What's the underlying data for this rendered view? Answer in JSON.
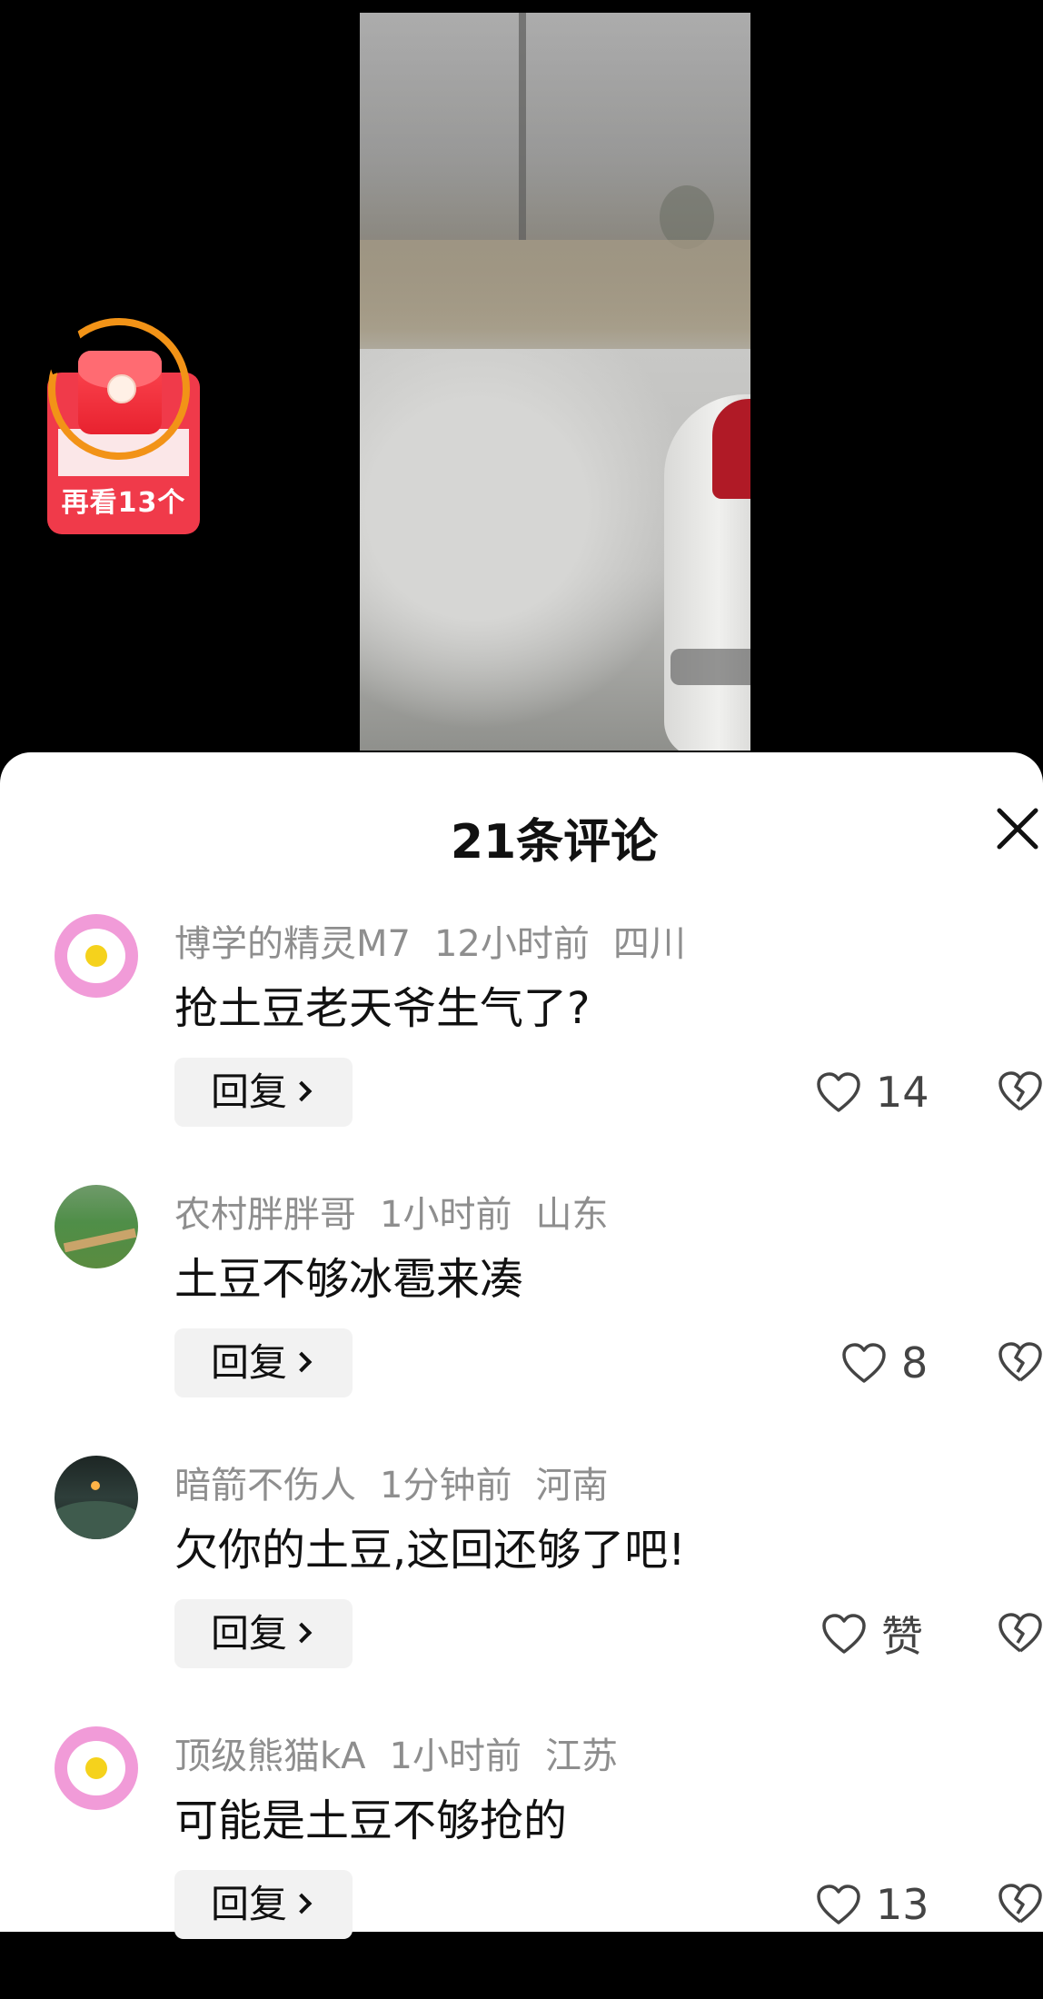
{
  "redpacket": {
    "label": "再看13个"
  },
  "sheet": {
    "title": "21条评论"
  },
  "comments": [
    {
      "username": "博学的精灵M7",
      "time": "12小时前",
      "location": "四川",
      "text": "抢土豆老天爷生气了?",
      "reply_label": "回复",
      "like_label": "14",
      "avatar": "egg-avatar"
    },
    {
      "username": "农村胖胖哥",
      "time": "1小时前",
      "location": "山东",
      "text": "土豆不够冰雹来凑",
      "reply_label": "回复",
      "like_label": "8",
      "avatar": "field-avatar"
    },
    {
      "username": "暗箭不伤人",
      "time": "1分钟前",
      "location": "河南",
      "text": "欠你的土豆,这回还够了吧!",
      "reply_label": "回复",
      "like_label": "赞",
      "avatar": "night-avatar"
    },
    {
      "username": "顶级熊猫kA",
      "time": "1小时前",
      "location": "江苏",
      "text": "可能是土豆不够抢的",
      "reply_label": "回复",
      "like_label": "13",
      "avatar": "egg-avatar"
    }
  ],
  "icons": {
    "close": "close-icon",
    "like": "heart-icon",
    "dislike": "broken-heart-icon"
  },
  "colors": {
    "accent_red": "#f03a4a",
    "ring_orange": "#f29317",
    "meta_gray": "#8e8e8e"
  }
}
